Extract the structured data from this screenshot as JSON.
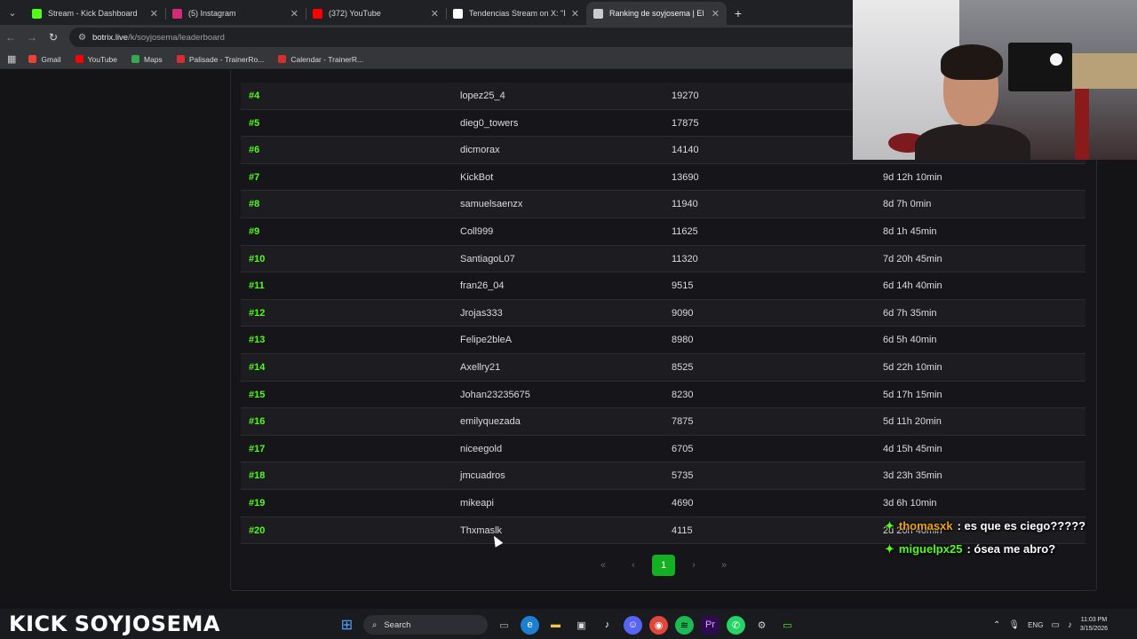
{
  "browser": {
    "tabs": [
      {
        "title": "Stream - Kick Dashboard",
        "icon": "kick-icon",
        "color": "#53fc18",
        "active": false
      },
      {
        "title": "(5) Instagram",
        "icon": "instagram-icon",
        "color": "#d62976",
        "active": false
      },
      {
        "title": "(372) YouTube",
        "icon": "youtube-icon",
        "color": "#ff0000",
        "active": false
      },
      {
        "title": "Tendencias Stream on X: \"Ring",
        "icon": "x-icon",
        "color": "#ffffff",
        "active": false
      },
      {
        "title": "Ranking de soyjosema | El mej",
        "icon": "botrix-icon",
        "color": "#cccccc",
        "active": true
      }
    ],
    "new_tab": "+",
    "url_host": "botrix.live",
    "url_path": "/k/soyjosema/leaderboard",
    "bookmarks": [
      {
        "label": "Gmail",
        "color": "#ea4335"
      },
      {
        "label": "YouTube",
        "color": "#ff0000"
      },
      {
        "label": "Maps",
        "color": "#34a853"
      },
      {
        "label": "Palisade - TrainerRo...",
        "color": "#d32f2f"
      },
      {
        "label": "Calendar - TrainerR...",
        "color": "#d32f2f"
      }
    ]
  },
  "leaderboard": {
    "rows": [
      {
        "rank": "#4",
        "user": "lopez25_4",
        "points": "19270",
        "time": ""
      },
      {
        "rank": "#5",
        "user": "dieg0_towers",
        "points": "17875",
        "time": ""
      },
      {
        "rank": "#6",
        "user": "dicmorax",
        "points": "14140",
        "time": ""
      },
      {
        "rank": "#7",
        "user": "KickBot",
        "points": "13690",
        "time": "9d 12h 10min"
      },
      {
        "rank": "#8",
        "user": "samuelsaenzx",
        "points": "11940",
        "time": "8d 7h 0min"
      },
      {
        "rank": "#9",
        "user": "Coll999",
        "points": "11625",
        "time": "8d 1h 45min"
      },
      {
        "rank": "#10",
        "user": "SantiagoL07",
        "points": "11320",
        "time": "7d 20h 45min"
      },
      {
        "rank": "#11",
        "user": "fran26_04",
        "points": "9515",
        "time": "6d 14h 40min"
      },
      {
        "rank": "#12",
        "user": "Jrojas333",
        "points": "9090",
        "time": "6d 7h 35min"
      },
      {
        "rank": "#13",
        "user": "Felipe2bleA",
        "points": "8980",
        "time": "6d 5h 40min"
      },
      {
        "rank": "#14",
        "user": "Axellry21",
        "points": "8525",
        "time": "5d 22h 10min"
      },
      {
        "rank": "#15",
        "user": "Johan23235675",
        "points": "8230",
        "time": "5d 17h 15min"
      },
      {
        "rank": "#16",
        "user": "emilyquezada",
        "points": "7875",
        "time": "5d 11h 20min"
      },
      {
        "rank": "#17",
        "user": "niceegold",
        "points": "6705",
        "time": "4d 15h 45min"
      },
      {
        "rank": "#18",
        "user": "jmcuadros",
        "points": "5735",
        "time": "3d 23h 35min"
      },
      {
        "rank": "#19",
        "user": "mikeapi",
        "points": "4690",
        "time": "3d 6h 10min"
      },
      {
        "rank": "#20",
        "user": "Thxmaslk",
        "points": "4115",
        "time": "2d 20h 40min"
      }
    ],
    "pagination": {
      "first": "«",
      "prev": "‹",
      "current": "1",
      "next": "›",
      "last": "»"
    }
  },
  "overlay": {
    "chat": [
      {
        "user": "thomasxk",
        "message": ": es que es ciego?????"
      },
      {
        "user": "miguelpx25",
        "message": ": ósea me abro?"
      }
    ],
    "brand_kick": "KICK",
    "brand_name": "SOYJOSEMA"
  },
  "taskbar": {
    "search_label": "Search",
    "lang": "ENG",
    "time": "11:03 PM",
    "date": "3/15/2026"
  }
}
